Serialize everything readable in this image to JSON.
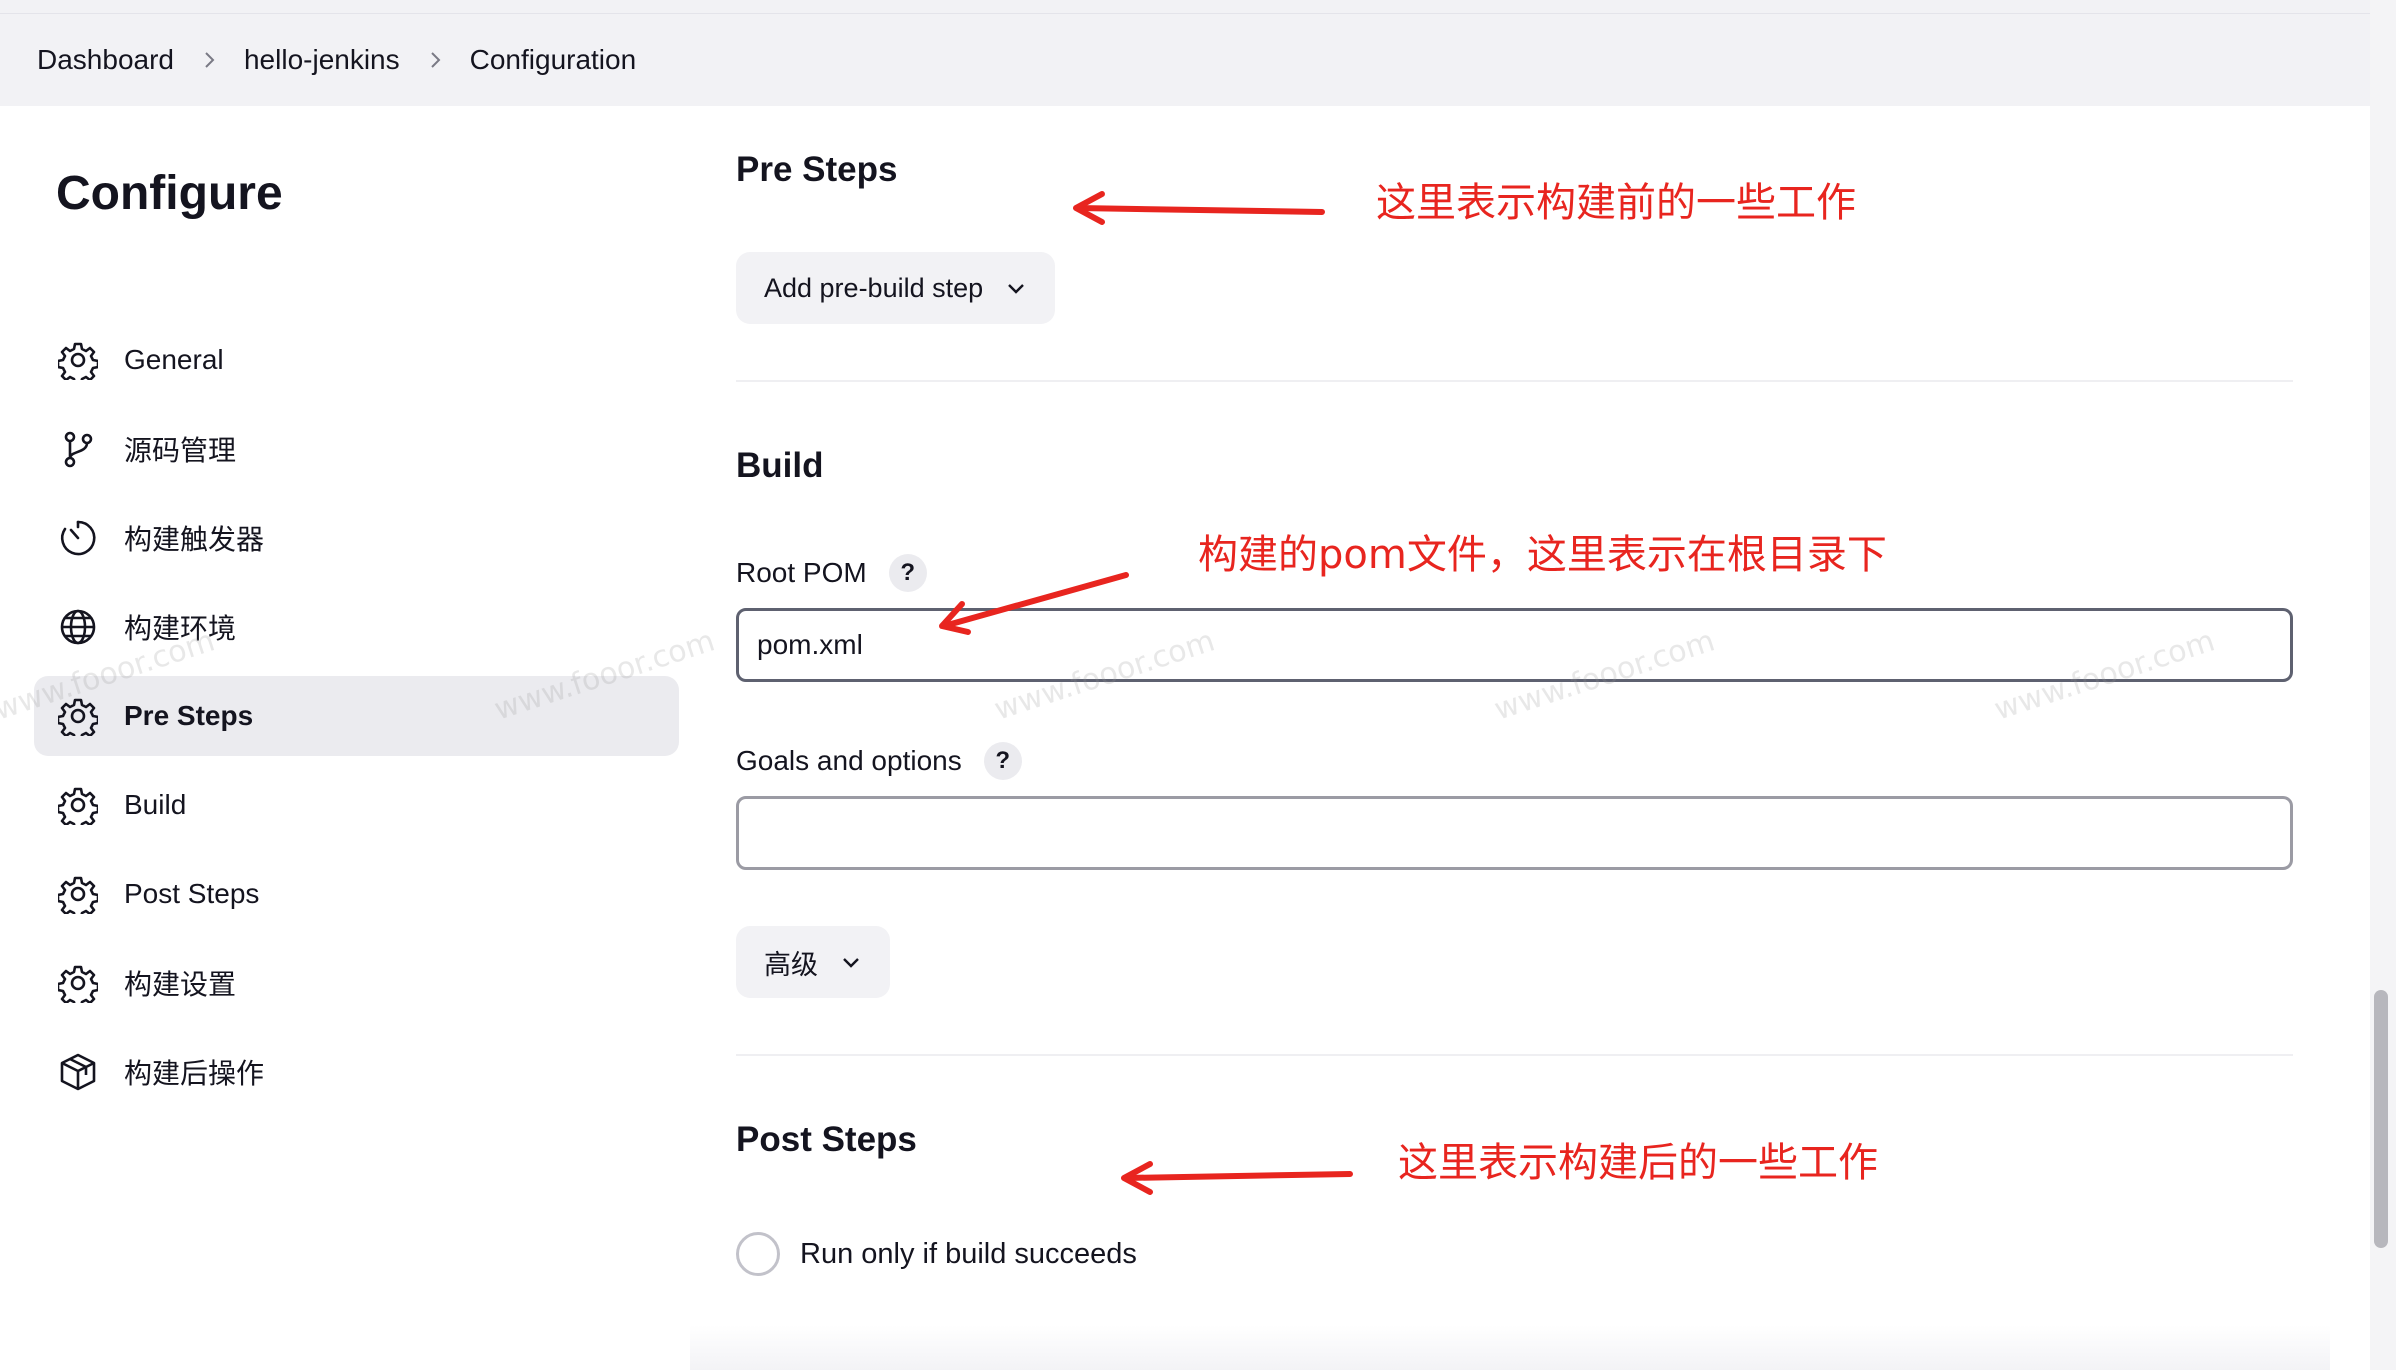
{
  "breadcrumb": {
    "items": [
      "Dashboard",
      "hello-jenkins",
      "Configuration"
    ]
  },
  "sidebar": {
    "title": "Configure",
    "items": [
      {
        "label": "General",
        "icon": "gear-icon"
      },
      {
        "label": "源码管理",
        "icon": "branch-icon"
      },
      {
        "label": "构建触发器",
        "icon": "timer-icon"
      },
      {
        "label": "构建环境",
        "icon": "globe-icon"
      },
      {
        "label": "Pre Steps",
        "icon": "gear-icon",
        "active": true
      },
      {
        "label": "Build",
        "icon": "gear-icon"
      },
      {
        "label": "Post Steps",
        "icon": "gear-icon"
      },
      {
        "label": "构建设置",
        "icon": "gear-icon"
      },
      {
        "label": "构建后操作",
        "icon": "package-icon"
      }
    ]
  },
  "pre_steps": {
    "title": "Pre Steps",
    "add_button": "Add pre-build step"
  },
  "build": {
    "title": "Build",
    "root_pom_label": "Root POM",
    "root_pom_value": "pom.xml",
    "goals_label": "Goals and options",
    "goals_value": "",
    "advanced_button": "高级",
    "help_symbol": "?"
  },
  "post_steps": {
    "title": "Post Steps",
    "radio_label": "Run only if build succeeds"
  },
  "annotations": {
    "pre": "这里表示构建前的一些工作",
    "build": "构建的pom文件，这里表示在根目录下",
    "post": "这里表示构建后的一些工作"
  },
  "watermark": "www.fooor.com",
  "colors": {
    "annotation": "#e8251f",
    "active_nav": "#ebebef",
    "header_bg": "#f2f2f5"
  }
}
